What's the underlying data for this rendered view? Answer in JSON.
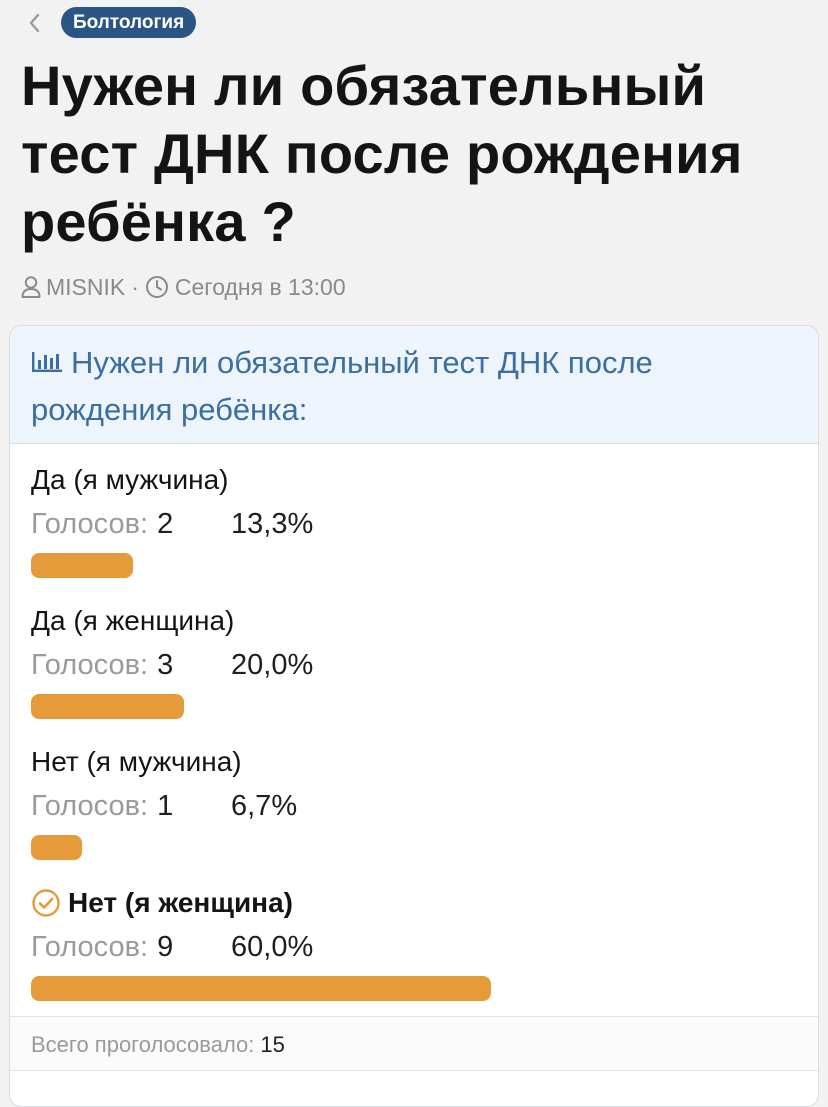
{
  "nav": {
    "back_icon": "chevron-left-icon",
    "category": "Болтология"
  },
  "thread": {
    "title": "Нужен ли обязательный тест ДНК после рождения ребёнка ?",
    "author": "MISNIK",
    "separator": "·",
    "date": "Сегодня в 13:00",
    "author_icon": "user-icon",
    "date_icon": "clock-icon"
  },
  "poll": {
    "icon": "bar-chart-icon",
    "question": "Нужен ли обязательный тест ДНК после рождения ребёнка:",
    "votes_label": "Голосов:",
    "options": [
      {
        "label": "Да (я мужчина)",
        "votes": "2",
        "percent_text": "13,3%",
        "percent": 13.3,
        "chosen": false
      },
      {
        "label": "Да (я женщина)",
        "votes": "3",
        "percent_text": "20,0%",
        "percent": 20.0,
        "chosen": false
      },
      {
        "label": "Нет (я мужчина)",
        "votes": "1",
        "percent_text": "6,7%",
        "percent": 6.7,
        "chosen": false
      },
      {
        "label": "Нет (я женщина)",
        "votes": "9",
        "percent_text": "60,0%",
        "percent": 60.0,
        "chosen": true
      }
    ],
    "total_label": "Всего проголосовало:",
    "total_value": "15",
    "bar_color": "#e59b3a",
    "chosen_icon": "check-circle-icon"
  },
  "colors": {
    "category_badge": "#2a5584",
    "poll_title": "#3a6fa0",
    "poll_header_bg": "#edf4fb"
  }
}
